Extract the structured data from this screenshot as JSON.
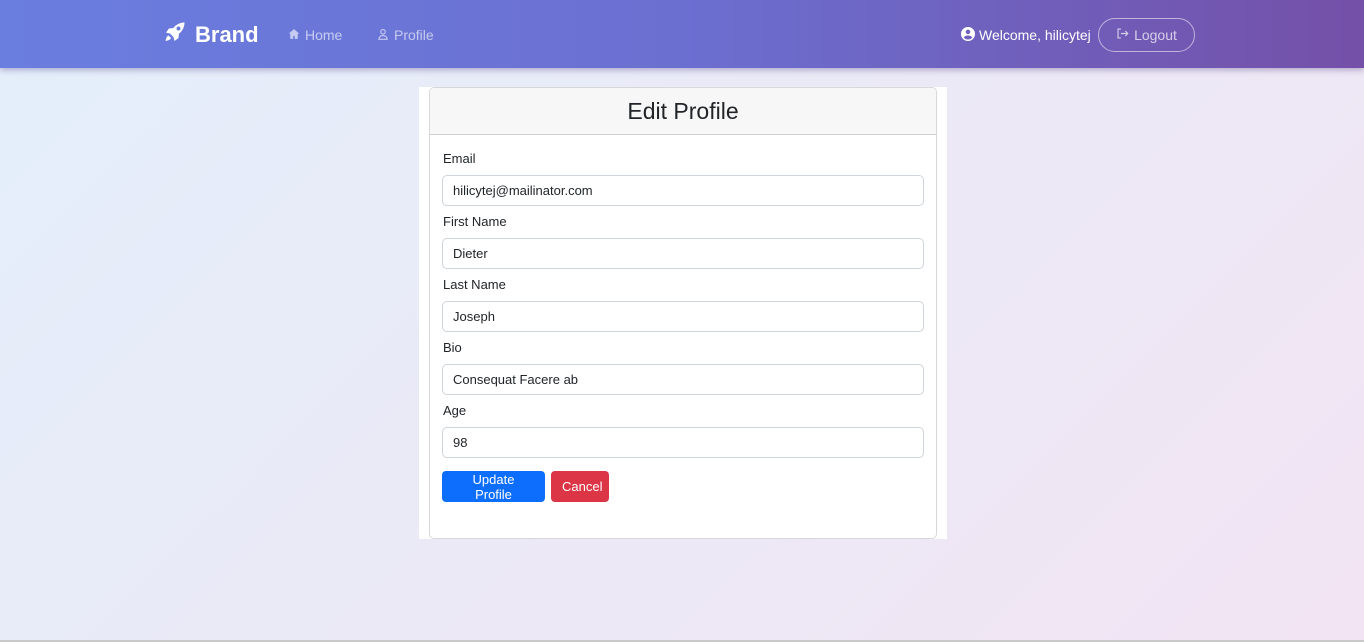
{
  "navbar": {
    "brand": "Brand",
    "links": [
      {
        "label": "Home",
        "icon": "house-icon"
      },
      {
        "label": "Profile",
        "icon": "person-icon"
      }
    ],
    "welcome": "Welcome, hilicytej",
    "logout": "Logout"
  },
  "form": {
    "title": "Edit Profile",
    "fields": [
      {
        "label": "Email",
        "value": "hilicytej@mailinator.com"
      },
      {
        "label": "First Name",
        "value": "Dieter"
      },
      {
        "label": "Last Name",
        "value": "Joseph"
      },
      {
        "label": "Bio",
        "value": "Consequat Facere ab"
      },
      {
        "label": "Age",
        "value": "98"
      }
    ],
    "submit": "Update Profile",
    "cancel": "Cancel"
  },
  "colors": {
    "primary": "#0d6efd",
    "danger": "#dc3545",
    "navbar_start": "#6a7ee0",
    "navbar_end": "#7450a8"
  }
}
